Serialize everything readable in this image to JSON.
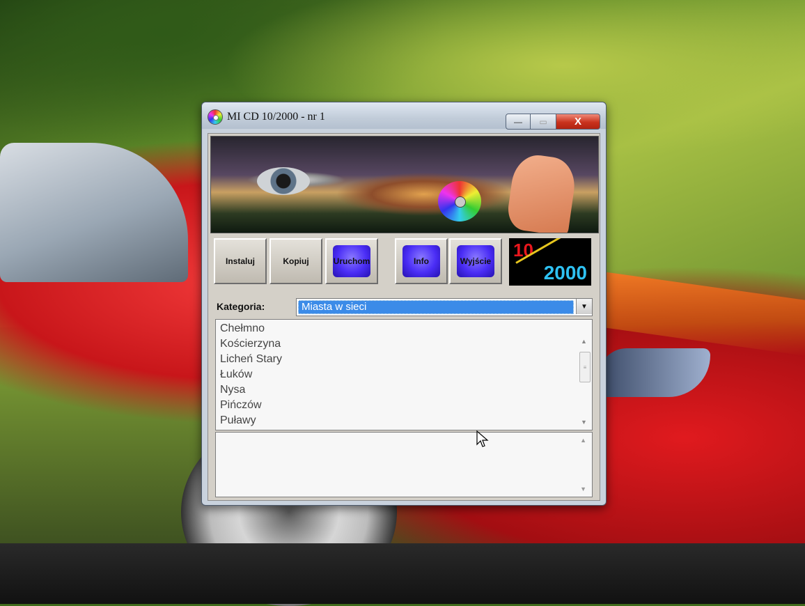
{
  "window": {
    "title": "MI CD 10/2000 - nr 1",
    "controls": {
      "minimize": "—",
      "maximize": "▭",
      "close": "X"
    }
  },
  "toolbar": {
    "buttons": [
      {
        "label": "Instaluj"
      },
      {
        "label": "Kopiuj"
      },
      {
        "label": "Uruchom"
      },
      {
        "label": "Info"
      },
      {
        "label": "Wyjście"
      }
    ]
  },
  "logo": {
    "top": "10",
    "bottom": "2000"
  },
  "category": {
    "label": "Kategoria:",
    "selected": "Miasta w sieci"
  },
  "list": {
    "items": [
      "Chełmno",
      "Kościerzyna",
      "Licheń Stary",
      "Łuków",
      "Nysa",
      "Pińczów",
      "Puławy"
    ]
  },
  "colors": {
    "select_highlight": "#3b8be8",
    "button_blue": "#4a2df5",
    "logo_red": "#e8171d",
    "logo_cyan": "#2ec1f2",
    "close_red": "#c9321d"
  },
  "icons": [
    "cd-icon",
    "minimize-icon",
    "maximize-icon",
    "close-icon",
    "dropdown-arrow-icon",
    "mouse-cursor-icon"
  ]
}
